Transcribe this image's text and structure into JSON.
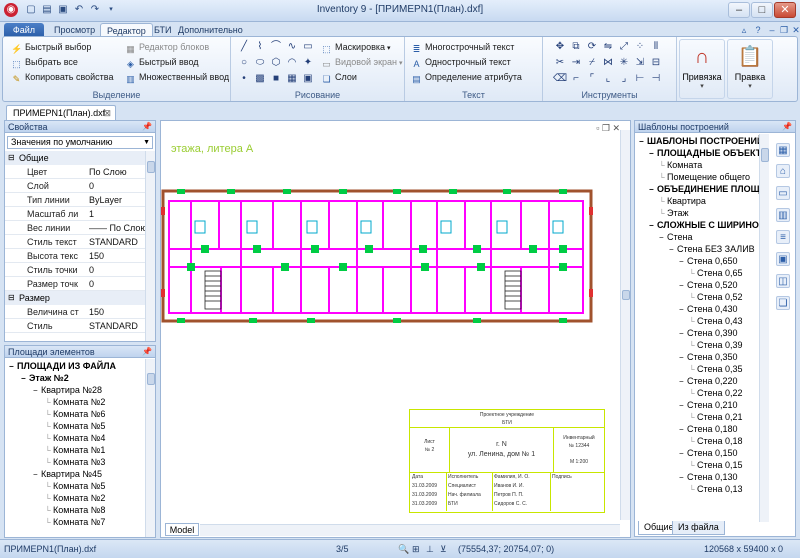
{
  "window": {
    "title": "Inventory 9 - [ПРИМЕРN1(План).dxf]",
    "minimize_glyph": "–",
    "maximize_glyph": "□",
    "close_glyph": "✕"
  },
  "ribbon_tabs": [
    "Файл",
    "Просмотр",
    "Редактор",
    "БТИ",
    "Дополнительно"
  ],
  "ribbon": {
    "selection": {
      "label": "Выделение",
      "items": [
        "Быстрый выбор",
        "Выбрать все",
        "Копировать свойства",
        "Редактор блоков",
        "Быстрый ввод",
        "Множественный ввод"
      ]
    },
    "drawing": {
      "label": "Рисование",
      "items": [
        "Маскировка",
        "Видовой экран",
        "Слои"
      ]
    },
    "text": {
      "label": "Текст",
      "items": [
        "Многострочный текст",
        "Однострочный текст",
        "Определение атрибута"
      ]
    },
    "tools": {
      "label": "Инструменты"
    },
    "snap": {
      "label": "Привязка"
    },
    "edit": {
      "label": "Правка"
    }
  },
  "document_tab": "ПРИМЕРN1(План).dxf",
  "properties_panel": {
    "title": "Свойства",
    "dropdown_value": "Значения по умолчанию",
    "sections": [
      {
        "name": "Общие",
        "rows": [
          {
            "name": "Цвет",
            "value": "По Слою"
          },
          {
            "name": "Слой",
            "value": "0"
          },
          {
            "name": "Тип линии",
            "value": "ByLayer"
          },
          {
            "name": "Масштаб ли",
            "value": "1"
          },
          {
            "name": "Вес линии",
            "value": "—— По Слою"
          },
          {
            "name": "Стиль текст",
            "value": "STANDARD"
          },
          {
            "name": "Высота текс",
            "value": "150"
          },
          {
            "name": "Стиль точки",
            "value": "0"
          },
          {
            "name": "Размер точк",
            "value": "0"
          }
        ]
      },
      {
        "name": "Размер",
        "rows": [
          {
            "name": "Величина ст",
            "value": "150"
          },
          {
            "name": "Стиль",
            "value": "STANDARD"
          }
        ]
      }
    ]
  },
  "areas_panel": {
    "title": "Площади элементов",
    "tree": [
      {
        "label": "ПЛОЩАДИ ИЗ ФАЙЛА",
        "bold": true,
        "level": 0,
        "toggle": "−"
      },
      {
        "label": "Этаж №2",
        "bold": true,
        "level": 1,
        "toggle": "−"
      },
      {
        "label": "Квартира №28",
        "bold": false,
        "level": 2,
        "toggle": "−"
      },
      {
        "label": "Комната №2",
        "bold": false,
        "level": 3,
        "toggle": ""
      },
      {
        "label": "Комната №6",
        "bold": false,
        "level": 3,
        "toggle": ""
      },
      {
        "label": "Комната №5",
        "bold": false,
        "level": 3,
        "toggle": ""
      },
      {
        "label": "Комната №4",
        "bold": false,
        "level": 3,
        "toggle": ""
      },
      {
        "label": "Комната №1",
        "bold": false,
        "level": 3,
        "toggle": ""
      },
      {
        "label": "Комната №3",
        "bold": false,
        "level": 3,
        "toggle": ""
      },
      {
        "label": "Квартира №45",
        "bold": false,
        "level": 2,
        "toggle": "−"
      },
      {
        "label": "Комната №5",
        "bold": false,
        "level": 3,
        "toggle": ""
      },
      {
        "label": "Комната №2",
        "bold": false,
        "level": 3,
        "toggle": ""
      },
      {
        "label": "Комната №8",
        "bold": false,
        "level": 3,
        "toggle": ""
      },
      {
        "label": "Комната №7",
        "bold": false,
        "level": 3,
        "toggle": ""
      }
    ]
  },
  "canvas": {
    "caption": "этажа, литера А",
    "model_tab": "Model",
    "stamp": {
      "org": "Проектное учреждение",
      "org2": "БТИ",
      "sheet_label": "Лист",
      "sheet_no": "№ 2",
      "address_city": "г. N",
      "address_street": "ул. Ленина, дом № 1",
      "inv_label": "Инвентарный",
      "inv_no": "№ 12344",
      "scale": "М 1:200",
      "col_date": "Дата",
      "col_exec": "Исполнитель",
      "col_fio": "Фамилия, И. О.",
      "col_sign": "Подпись",
      "rows": [
        {
          "date": "31.03.2009",
          "role": "Специалист",
          "name": "Иванов И. И."
        },
        {
          "date": "31.03.2009",
          "role": "Нач. филиала",
          "name": "Петров П. П."
        },
        {
          "date": "31.03.2009",
          "role": "БТИ",
          "name": "Сидоров С. С."
        }
      ]
    }
  },
  "templates_panel": {
    "title": "Шаблоны построений",
    "tree": [
      {
        "label": "ШАБЛОНЫ ПОСТРОЕНИЙ",
        "bold": true,
        "level": 0,
        "toggle": "−"
      },
      {
        "label": "ПЛОЩАДНЫЕ ОБЪЕКТЫ",
        "bold": true,
        "level": 1,
        "toggle": "−"
      },
      {
        "label": "Комната",
        "bold": false,
        "level": 2,
        "toggle": ""
      },
      {
        "label": "Помещение общего",
        "bold": false,
        "level": 2,
        "toggle": ""
      },
      {
        "label": "ОБЪЕДИНЕНИЕ ПЛОЩ",
        "bold": true,
        "level": 1,
        "toggle": "−"
      },
      {
        "label": "Квартира",
        "bold": false,
        "level": 2,
        "toggle": ""
      },
      {
        "label": "Этаж",
        "bold": false,
        "level": 2,
        "toggle": ""
      },
      {
        "label": "СЛОЖНЫЕ С ШИРИНО",
        "bold": true,
        "level": 1,
        "toggle": "−"
      },
      {
        "label": "Стена",
        "bold": false,
        "level": 2,
        "toggle": "−"
      },
      {
        "label": "Стена БЕЗ ЗАЛИВ",
        "bold": false,
        "level": 3,
        "toggle": "−"
      },
      {
        "label": "Стена 0,650",
        "bold": false,
        "level": 4,
        "toggle": "−"
      },
      {
        "label": "Стена 0,65",
        "bold": false,
        "level": 5,
        "toggle": ""
      },
      {
        "label": "Стена 0,520",
        "bold": false,
        "level": 4,
        "toggle": "−"
      },
      {
        "label": "Стена 0,52",
        "bold": false,
        "level": 5,
        "toggle": ""
      },
      {
        "label": "Стена 0,430",
        "bold": false,
        "level": 4,
        "toggle": "−"
      },
      {
        "label": "Стена 0,43",
        "bold": false,
        "level": 5,
        "toggle": ""
      },
      {
        "label": "Стена 0,390",
        "bold": false,
        "level": 4,
        "toggle": "−"
      },
      {
        "label": "Стена 0,39",
        "bold": false,
        "level": 5,
        "toggle": ""
      },
      {
        "label": "Стена 0,350",
        "bold": false,
        "level": 4,
        "toggle": "−"
      },
      {
        "label": "Стена 0,35",
        "bold": false,
        "level": 5,
        "toggle": ""
      },
      {
        "label": "Стена 0,220",
        "bold": false,
        "level": 4,
        "toggle": "−"
      },
      {
        "label": "Стена 0,22",
        "bold": false,
        "level": 5,
        "toggle": ""
      },
      {
        "label": "Стена 0,210",
        "bold": false,
        "level": 4,
        "toggle": "−"
      },
      {
        "label": "Стена 0,21",
        "bold": false,
        "level": 5,
        "toggle": ""
      },
      {
        "label": "Стена 0,180",
        "bold": false,
        "level": 4,
        "toggle": "−"
      },
      {
        "label": "Стена 0,18",
        "bold": false,
        "level": 5,
        "toggle": ""
      },
      {
        "label": "Стена 0,150",
        "bold": false,
        "level": 4,
        "toggle": "−"
      },
      {
        "label": "Стена 0,15",
        "bold": false,
        "level": 5,
        "toggle": ""
      },
      {
        "label": "Стена 0,130",
        "bold": false,
        "level": 4,
        "toggle": "−"
      },
      {
        "label": "Стена 0,13",
        "bold": false,
        "level": 5,
        "toggle": ""
      }
    ],
    "bottom_tabs": [
      "Общие",
      "Из файла"
    ]
  },
  "statusbar": {
    "file": "ПРИМЕРN1(План).dxf",
    "page": "3/5",
    "coords": "(75554,37; 20754,07; 0)",
    "size": "120568 x 59400 x 0"
  },
  "colors": {
    "accent": "#2b5ea8",
    "ribbon_bg": "#d6e3f3",
    "wall_magenta": "#ff00ff",
    "wall_brown": "#a0522d",
    "stamp_yellow": "#c8e600",
    "caption_green": "#9acd32"
  }
}
